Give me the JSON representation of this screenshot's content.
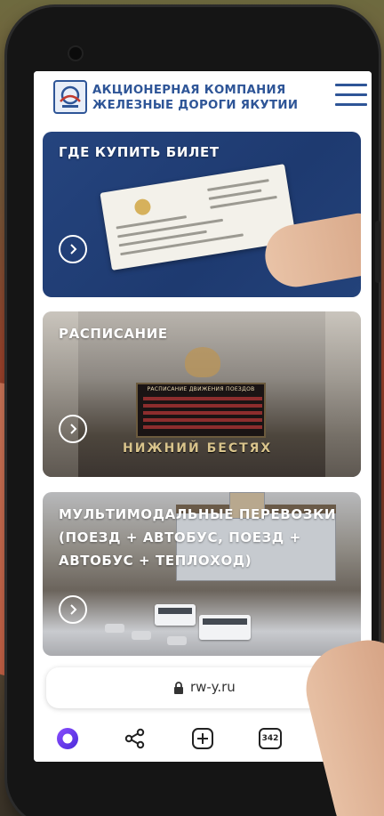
{
  "header": {
    "company_line1": "АКЦИОНЕРНАЯ КОМПАНИЯ",
    "company_line2": "ЖЕЛЕЗНЫЕ ДОРОГИ ЯКУТИИ"
  },
  "cards": [
    {
      "title": "ГДЕ КУПИТЬ БИЛЕТ"
    },
    {
      "title": "РАСПИСАНИЕ",
      "board_title": "РАСПИСАНИЕ ДВИЖЕНИЯ ПОЕЗДОВ",
      "station_name": "НИЖНИЙ БЕСТЯХ"
    },
    {
      "title": "МУЛЬТИМОДАЛЬНЫЕ ПЕРЕВОЗКИ (ПОЕЗД + АВТОБУС, ПОЕЗД + АВТОБУС + ТЕПЛОХОД)"
    }
  ],
  "browser": {
    "url": "rw-y.ru",
    "tab_count": "342"
  },
  "colors": {
    "brand": "#2e5597",
    "card1_bg": "#25447e"
  },
  "icons": {
    "assistant": "alice-icon",
    "share": "share-icon",
    "new_tab": "plus-square-icon",
    "tabs": "tab-count-icon",
    "profile": "incognito-icon"
  }
}
